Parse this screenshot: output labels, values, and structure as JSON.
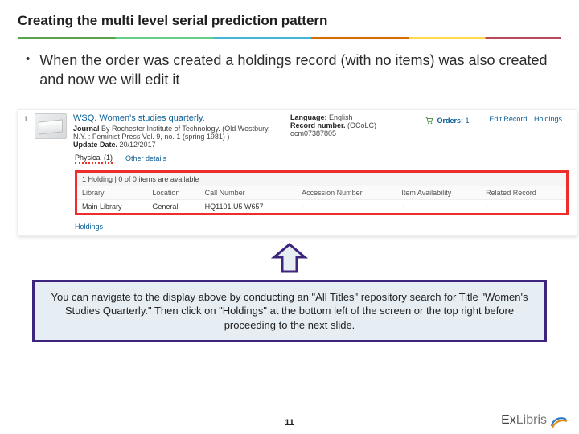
{
  "title": "Creating the multi level serial prediction pattern",
  "bullet": "When the order was created a holdings record (with no items) was also created and now we will edit it",
  "record": {
    "rownum": "1",
    "title": "WSQ. Women's studies quarterly.",
    "journal_label": "Journal",
    "journal_value": "By Rochester Institute of Technology. (Old Westbury, N.Y. : Feminist Press Vol. 9, no. 1 (spring 1981) )",
    "update_label": "Update Date.",
    "update_value": "20/12/2017",
    "lang_label": "Language:",
    "lang_value": "English",
    "recnum_label": "Record number.",
    "recnum_value": "(OCoLC) ocm07387805",
    "orders_label": "Orders:",
    "orders_value": "1",
    "action_edit": "Edit Record",
    "action_holdings": "Holdings",
    "action_more": "..."
  },
  "tabs": {
    "physical": "Physical (1)",
    "other": "Other details"
  },
  "holdings": {
    "header": "1 Holding | 0 of 0 items are available",
    "cols": {
      "library": "Library",
      "location": "Location",
      "callno": "Call Number",
      "accession": "Accession Number",
      "avail": "Item Availability",
      "related": "Related Record"
    },
    "row": {
      "library": "Main Library",
      "location": "General",
      "callno": "HQ1101.U5 W657",
      "accession": "-",
      "avail": "-",
      "related": "-"
    },
    "link": "Holdings"
  },
  "callout": "You can navigate to the display above by conducting an \"All Titles\" repository search for Title \"Women's Studies Quarterly.\" Then click on \"Holdings\" at the bottom left of the screen or the top right before proceeding to the next slide.",
  "page_number": "11",
  "logo": {
    "part1": "Ex",
    "part2": "Libris"
  }
}
